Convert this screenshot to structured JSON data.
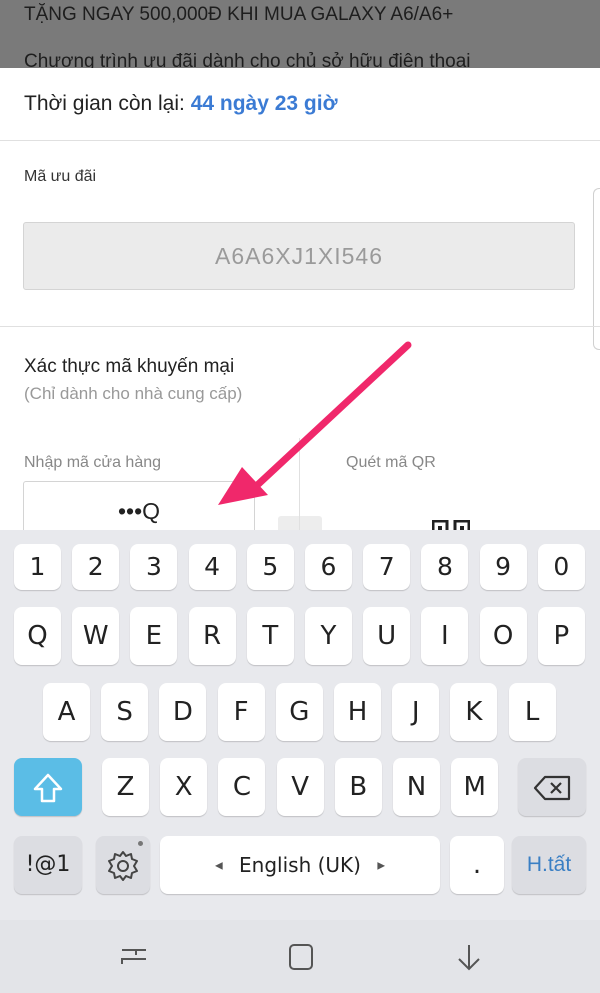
{
  "background_page": {
    "headline": "TẶNG NGAY 500,000Đ KHI MUA GALAXY A6/A6+",
    "description": "Chương trình ưu đãi dành cho chủ sở hữu điện thoại"
  },
  "sheet": {
    "time_label": "Thời gian còn lại:",
    "time_value": "44 ngày 23 giờ",
    "code_title": "Mã ưu đãi",
    "code_value": "A6A6XJ1XI546",
    "verify_title": "Xác thực mã khuyến mại",
    "verify_subtitle": "(Chỉ dành cho nhà cung cấp)",
    "store_code_label": "Nhập mã cửa hàng",
    "store_code_value": "•••Q",
    "qr_label": "Quét mã QR"
  },
  "colors": {
    "accent_blue": "#3b7bd4",
    "shift_key": "#5bbde6",
    "arrow": "#f0286b"
  },
  "keyboard": {
    "number_row": [
      "1",
      "2",
      "3",
      "4",
      "5",
      "6",
      "7",
      "8",
      "9",
      "0"
    ],
    "row1": [
      "Q",
      "W",
      "E",
      "R",
      "T",
      "Y",
      "U",
      "I",
      "O",
      "P"
    ],
    "row2": [
      "A",
      "S",
      "D",
      "F",
      "G",
      "H",
      "J",
      "K",
      "L"
    ],
    "row3": [
      "Z",
      "X",
      "C",
      "V",
      "B",
      "N",
      "M"
    ],
    "symbols_key": "!@1",
    "space_label": "English (UK)",
    "period_key": ".",
    "done_key": "H.tất",
    "shift_icon": "shift-up-arrow-icon",
    "backspace_icon": "backspace-icon",
    "settings_icon": "gear-icon"
  },
  "navbar": {
    "icons": [
      "recent-apps-icon",
      "home-icon",
      "back-icon"
    ]
  }
}
